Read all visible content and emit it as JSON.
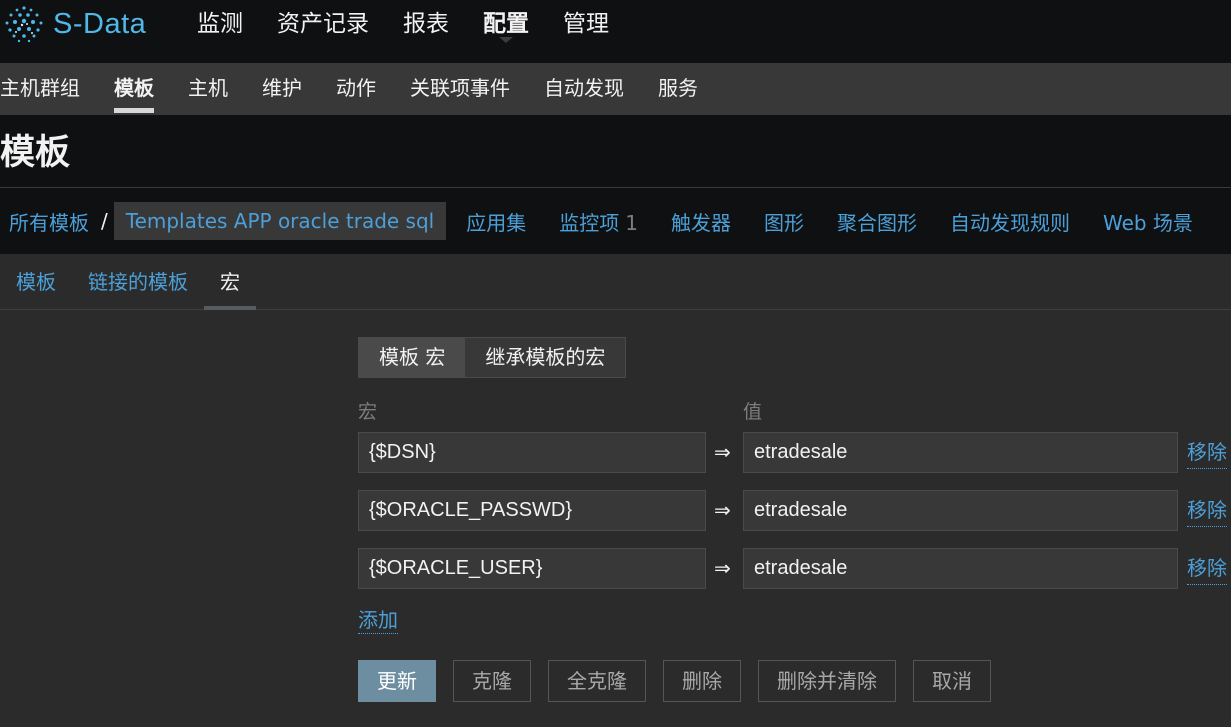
{
  "brand": {
    "name": "S-Data",
    "accent": "#4fb8e8"
  },
  "top_menu": [
    {
      "label": "监测",
      "active": false
    },
    {
      "label": "资产记录",
      "active": false
    },
    {
      "label": "报表",
      "active": false
    },
    {
      "label": "配置",
      "active": true
    },
    {
      "label": "管理",
      "active": false
    }
  ],
  "sub_menu": [
    {
      "label": "主机群组",
      "active": false
    },
    {
      "label": "模板",
      "active": true
    },
    {
      "label": "主机",
      "active": false
    },
    {
      "label": "维护",
      "active": false
    },
    {
      "label": "动作",
      "active": false
    },
    {
      "label": "关联项事件",
      "active": false
    },
    {
      "label": "自动发现",
      "active": false
    },
    {
      "label": "服务",
      "active": false
    }
  ],
  "page_title": "模板",
  "breadcrumb": {
    "root": "所有模板",
    "separator": "/",
    "current": "Templates APP oracle trade sql",
    "links": [
      {
        "label": "应用集",
        "count": ""
      },
      {
        "label": "监控项",
        "count": "1"
      },
      {
        "label": "触发器",
        "count": ""
      },
      {
        "label": "图形",
        "count": ""
      },
      {
        "label": "聚合图形",
        "count": ""
      },
      {
        "label": "自动发现规则",
        "count": ""
      },
      {
        "label": "Web 场景",
        "count": ""
      }
    ]
  },
  "tabs": [
    {
      "label": "模板",
      "active": false
    },
    {
      "label": "链接的模板",
      "active": false
    },
    {
      "label": "宏",
      "active": true
    }
  ],
  "macro_toggle": {
    "template": "模板 宏",
    "inherited": "继承模板的宏"
  },
  "columns": {
    "macro": "宏",
    "value": "值"
  },
  "macros": [
    {
      "macro": "{$DSN}",
      "value": "etradesale"
    },
    {
      "macro": "{$ORACLE_PASSWD}",
      "value": "etradesale"
    },
    {
      "macro": "{$ORACLE_USER}",
      "value": "etradesale"
    }
  ],
  "arrow_glyph": "⇒",
  "remove_label": "移除",
  "add_label": "添加",
  "buttons": {
    "update": "更新",
    "clone": "克隆",
    "full_clone": "全克隆",
    "delete": "删除",
    "delete_clear": "删除并清除",
    "cancel": "取消"
  }
}
